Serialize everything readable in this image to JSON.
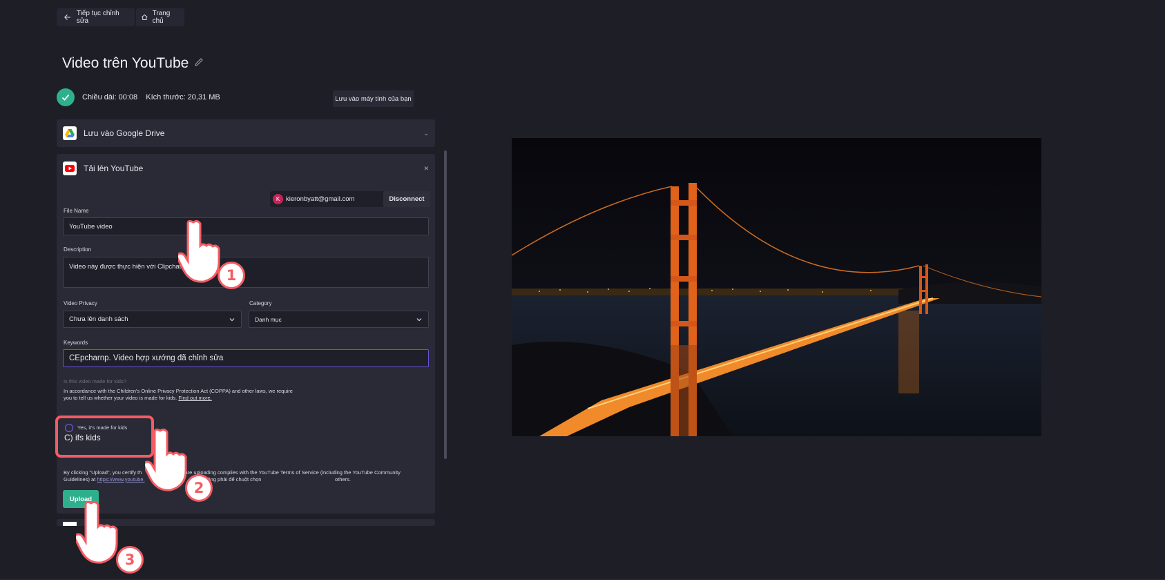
{
  "top_nav": {
    "back_label": "Tiếp tục chỉnh sửa",
    "home_label": "Trang chủ"
  },
  "page": {
    "title": "Video trên YouTube"
  },
  "export_info": {
    "duration_label": "Chiều dài: 00:08",
    "size_label": "Kích thước: 20,31 MB",
    "save_pc_label": "Lưu vào máy tính của bạn"
  },
  "google_drive": {
    "label": "Lưu vào Google Drive"
  },
  "youtube": {
    "label": "Tải lên YouTube",
    "account": {
      "avatar_letter": "K",
      "email": "kieronbyatt@gmail.com",
      "disconnect_label": "Disconnect"
    },
    "file_name": {
      "label": "File Name",
      "value": "YouTube video"
    },
    "description": {
      "label": "Description",
      "value": "Video này được thực hiện với Clipchatrp"
    },
    "privacy": {
      "label": "Video Privacy",
      "value": "Chưa lên danh sách"
    },
    "category": {
      "label": "Category",
      "value": "Danh mục"
    },
    "keywords": {
      "label": "Keywords",
      "value": "CEpcharnp. Video hợp xướng đã chỉnh sửa"
    },
    "kids_question": "Is this video made for kids?",
    "coppa_text": "In accordance with the Children's Online Privacy Protection Act (COPPA) and other laws, we require",
    "coppa_text2": "you to tell us whether your video is made for kids.",
    "find_out_more": "Find out more.",
    "kids_yes_label": "Yes, it's made for kids",
    "kids_no_label": "C) ifs kids",
    "terms_line1": "By clicking \"Upload\", you certify th",
    "terms_line1b": "are uploading complies with the YouTube Terms of Service (including the YouTube Community",
    "terms_line2a": "Guidelines) at",
    "terms_link": "https://www.youtube.",
    "terms_line2b": "re không phải để chuột chọn",
    "terms_line2c": "others.",
    "upload_label": "Upload"
  },
  "steps": [
    "1",
    "2",
    "3"
  ],
  "colors": {
    "background": "#1e1e27",
    "panel": "#2a2a36",
    "accent_green": "#2fb08d",
    "highlight_red": "#f45c63",
    "youtube_red": "#ff0000",
    "radio_purple": "#7b5cf0"
  }
}
